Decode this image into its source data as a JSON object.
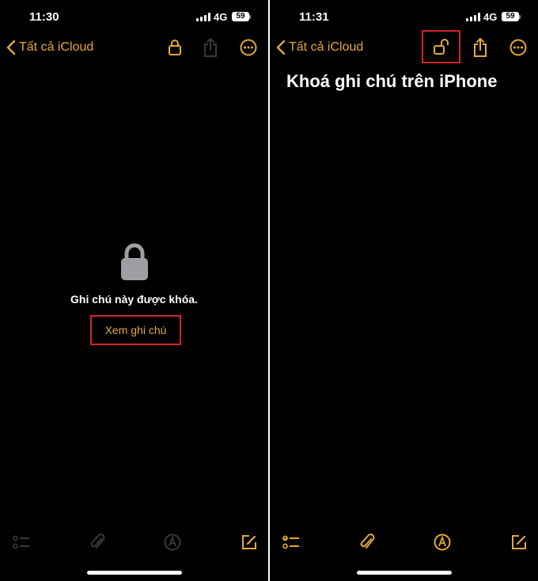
{
  "colors": {
    "accent": "#e5a93a",
    "highlight": "#d1252a",
    "background": "#000000",
    "disabled": "#3a3a3c"
  },
  "left": {
    "status": {
      "time": "11:30",
      "network": "4G",
      "battery": "59"
    },
    "nav": {
      "back_label": "Tất cả iCloud"
    },
    "toolbar_icons": [
      "checklist-icon",
      "paperclip-icon",
      "markup-icon",
      "compose-icon"
    ],
    "locked_message": "Ghi chú này được khóa.",
    "view_note_label": "Xem ghi chú"
  },
  "right": {
    "status": {
      "time": "11:31",
      "network": "4G",
      "battery": "59"
    },
    "nav": {
      "back_label": "Tất cả iCloud"
    },
    "note_title": "Khoá ghi chú trên iPhone",
    "toolbar_icons": [
      "checklist-icon",
      "paperclip-icon",
      "markup-icon",
      "compose-icon"
    ]
  }
}
